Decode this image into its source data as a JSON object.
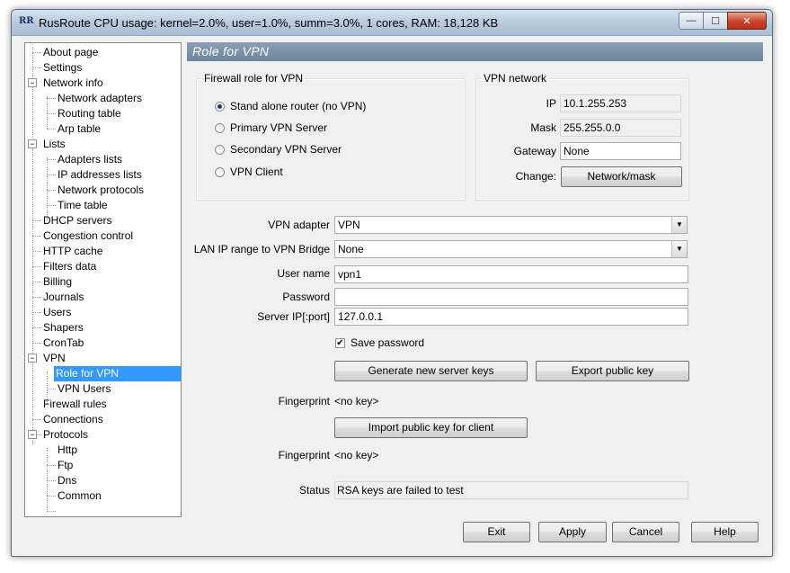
{
  "window": {
    "icon_text": "RR",
    "title": "RusRoute   CPU usage: kernel=2.0%, user=1.0%, summ=3.0%, 1 cores,   RAM: 18,128 KB",
    "min_glyph": "—",
    "max_glyph": "☐",
    "close_glyph": "✕"
  },
  "tree": {
    "items": [
      {
        "label": "About page"
      },
      {
        "label": "Settings"
      },
      {
        "label": "Network info"
      },
      {
        "label": "Network adapters"
      },
      {
        "label": "Routing table"
      },
      {
        "label": "Arp table"
      },
      {
        "label": "Lists"
      },
      {
        "label": "Adapters lists"
      },
      {
        "label": "IP addresses lists"
      },
      {
        "label": "Network protocols"
      },
      {
        "label": "Time table"
      },
      {
        "label": "DHCP servers"
      },
      {
        "label": "Congestion control"
      },
      {
        "label": "HTTP cache"
      },
      {
        "label": "Filters data"
      },
      {
        "label": "Billing"
      },
      {
        "label": "Journals"
      },
      {
        "label": "Users"
      },
      {
        "label": "Shapers"
      },
      {
        "label": "CronTab"
      },
      {
        "label": "VPN"
      },
      {
        "label": "Role for VPN"
      },
      {
        "label": "VPN Users"
      },
      {
        "label": "Firewall rules"
      },
      {
        "label": "Connections"
      },
      {
        "label": "Protocols"
      },
      {
        "label": "Http"
      },
      {
        "label": "Ftp"
      },
      {
        "label": "Dns"
      },
      {
        "label": "Common"
      }
    ],
    "expand_glyph": "−"
  },
  "panel": {
    "title": "Role for VPN",
    "firewall_role": {
      "label": "Firewall role for VPN",
      "options": [
        {
          "label": "Stand alone router (no VPN)"
        },
        {
          "label": "Primary VPN Server"
        },
        {
          "label": "Secondary VPN Server"
        },
        {
          "label": "VPN Client"
        }
      ]
    },
    "vpn_network": {
      "label": "VPN network",
      "ip_label": "IP",
      "ip_value": "10.1.255.253",
      "mask_label": "Mask",
      "mask_value": "255.255.0.0",
      "gateway_label": "Gateway",
      "gateway_value": "None",
      "change_label": "Change:",
      "change_button": "Network/mask"
    },
    "vpn_adapter_label": "VPN adapter",
    "vpn_adapter_value": "VPN",
    "lan_range_label": "LAN IP range to VPN Bridge",
    "lan_range_value": "None",
    "username_label": "User name",
    "username_value": "vpn1",
    "password_label": "Password",
    "password_value": "",
    "server_ip_label": "Server IP[:port]",
    "server_ip_value": "127.0.0.1",
    "save_password_label": "Save password",
    "save_password_check": "✔",
    "generate_keys_button": "Generate new server keys",
    "export_key_button": "Export public key",
    "fingerprint_label": "Fingerprint",
    "fingerprint_value_1": "<no key>",
    "import_key_button": "Import public key for client",
    "fingerprint_value_2": "<no key>",
    "status_label": "Status",
    "status_value": "RSA keys are failed to test",
    "combo_arrow": "▼"
  },
  "footer": {
    "exit": "Exit",
    "apply": "Apply",
    "cancel": "Cancel",
    "help": "Help"
  }
}
